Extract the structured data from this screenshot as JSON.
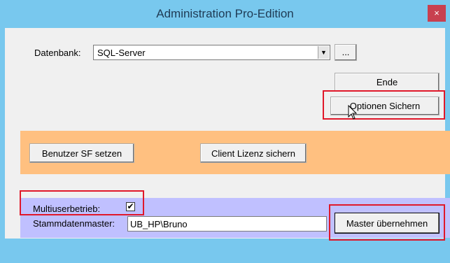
{
  "window": {
    "title": "Administration Pro-Edition",
    "close_icon": "×"
  },
  "database": {
    "label": "Datenbank:",
    "value": "SQL-Server",
    "dropdown_icon": "▼",
    "browse_label": "..."
  },
  "buttons": {
    "ende": "Ende",
    "optionen_sichern": "Optionen Sichern",
    "benutzer_sf": "Benutzer SF setzen",
    "client_lizenz": "Client Lizenz sichern",
    "master_uebernehmen": "Master übernehmen"
  },
  "multiuser": {
    "label": "Multiuserbetrieb:",
    "checked": true,
    "check_glyph": "✔"
  },
  "stammdaten": {
    "label": "Stammdatenmaster:",
    "value": "UB_HP\\Bruno"
  },
  "colors": {
    "title_bar": "#78c8ee",
    "orange_panel": "#ffc080",
    "purple_panel": "#c0c0ff",
    "highlight": "#e0182a"
  }
}
